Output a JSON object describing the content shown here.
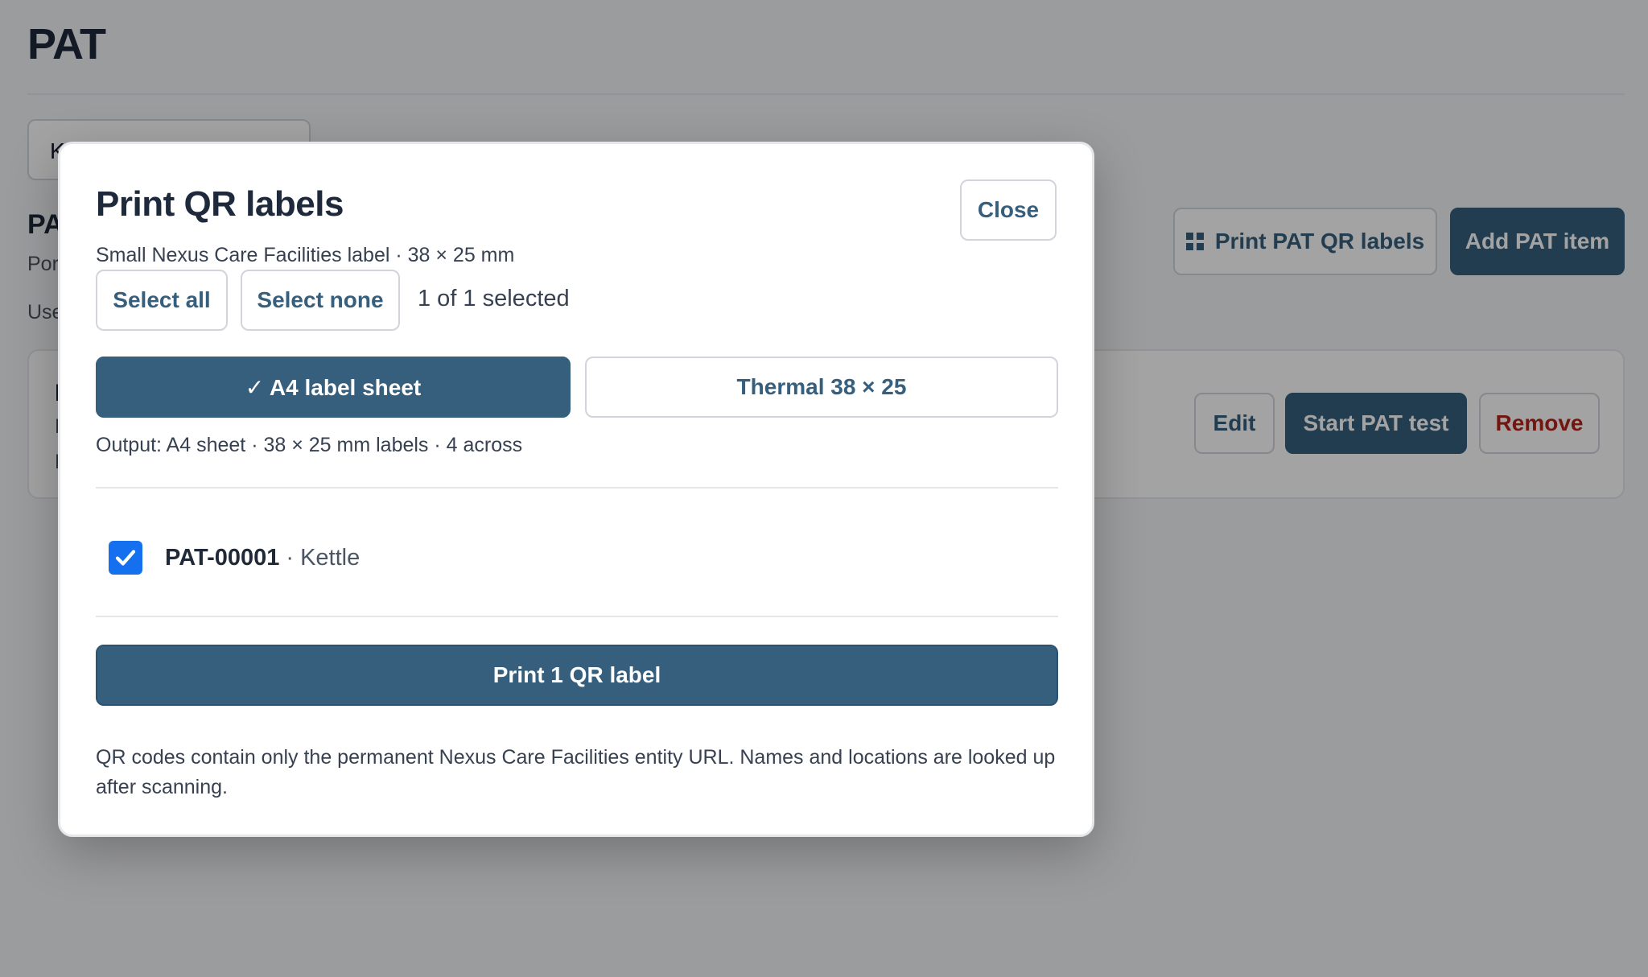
{
  "page": {
    "title": "PAT",
    "search_value": "K",
    "section_title": "PA",
    "section_sub": "Por",
    "section_sub2": "Use",
    "print_pat_qr_label": "Print PAT QR labels",
    "add_pat_item_label": "Add PAT item",
    "card": {
      "line1": "I",
      "line2": "K",
      "line3": "F",
      "edit_label": "Edit",
      "start_test_label": "Start PAT test",
      "remove_label": "Remove"
    }
  },
  "modal": {
    "title": "Print QR labels",
    "close_label": "Close",
    "subtitle": "Small Nexus Care Facilities label · 38 × 25 mm",
    "select_all_label": "Select all",
    "select_none_label": "Select none",
    "selected_count": "1 of 1 selected",
    "formats": {
      "active_label": "✓ A4 label sheet",
      "inactive_label": "Thermal 38 × 25"
    },
    "output_text": "Output: A4 sheet · 38 × 25 mm labels · 4 across",
    "items": [
      {
        "code": "PAT-00001",
        "separator": "·",
        "name": "Kettle",
        "checked": true
      }
    ],
    "print_label": "Print 1 QR label",
    "note": "QR codes contain only the permanent Nexus Care Facilities entity URL. Names and locations are looked up after scanning."
  },
  "colors": {
    "primary": "#365f7d",
    "danger": "#b42318",
    "checkbox": "#1570ef"
  }
}
